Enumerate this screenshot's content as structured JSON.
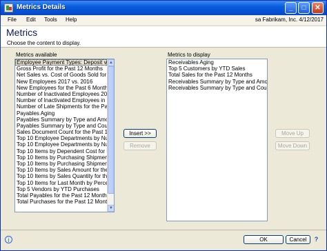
{
  "window": {
    "title": "Metrics Details",
    "minimize_glyph": "_",
    "maximize_glyph": "□",
    "close_glyph": "✕"
  },
  "menu": {
    "items": [
      "File",
      "Edit",
      "Tools",
      "Help"
    ],
    "user_label": "sa  Fabrikam, Inc.  4/12/2017"
  },
  "header": {
    "title": "Metrics",
    "instruction": "Choose the content to display."
  },
  "available": {
    "label": "Metrics available",
    "items": [
      "Employee Payment Types: Deposit vs",
      "Gross Profit for the Past 12 Months",
      "Net Sales vs. Cost of Goods Sold for t",
      "New Employees 2017 vs. 2016",
      "New Employees for the Past 6 Months",
      "Number of Inactivated Employees 201",
      "Number of Inactivated Employees in th",
      "Number of Late Shipments for the Pas",
      "Payables Aging",
      "Payables Summary by Type and Amou",
      "Payables Summary by Type and Coun",
      "Sales Document Count for the Past 12",
      "Top 10 Employee Departments by Nur",
      "Top 10 Employee Departments by Nur",
      "Top 10 Items by Dependent Cost for L",
      "Top 10 Items by Purchasing Shipment",
      "Top 10 Items by Purchasing Shipment",
      "Top 10 Items by Sales Amount for the",
      "Top 10 Items by Sales Quantity for th",
      "Top 10 Items for Last Month by Perce",
      "Top 5 Vendors by YTD Purchases",
      "Total Payables for the Past 12 Months",
      "Total Purchases for the Past 12 Month"
    ],
    "selected_index": 0
  },
  "display": {
    "label": "Metrics to display",
    "items": [
      "Receivables Aging",
      "Top 5 Customers by YTD Sales",
      "Total Sales for the Past 12 Months",
      "Receivables Summary by Type and Amou",
      "Receivables Summary by Type and Count"
    ]
  },
  "buttons": {
    "insert": "Insert >>",
    "remove": "Remove",
    "move_up": "Move Up",
    "move_down": "Move Down",
    "ok": "OK",
    "cancel": "Cancel"
  },
  "icons": {
    "scroll_up": "▲",
    "scroll_down": "▼",
    "status": "i",
    "help": "?"
  }
}
